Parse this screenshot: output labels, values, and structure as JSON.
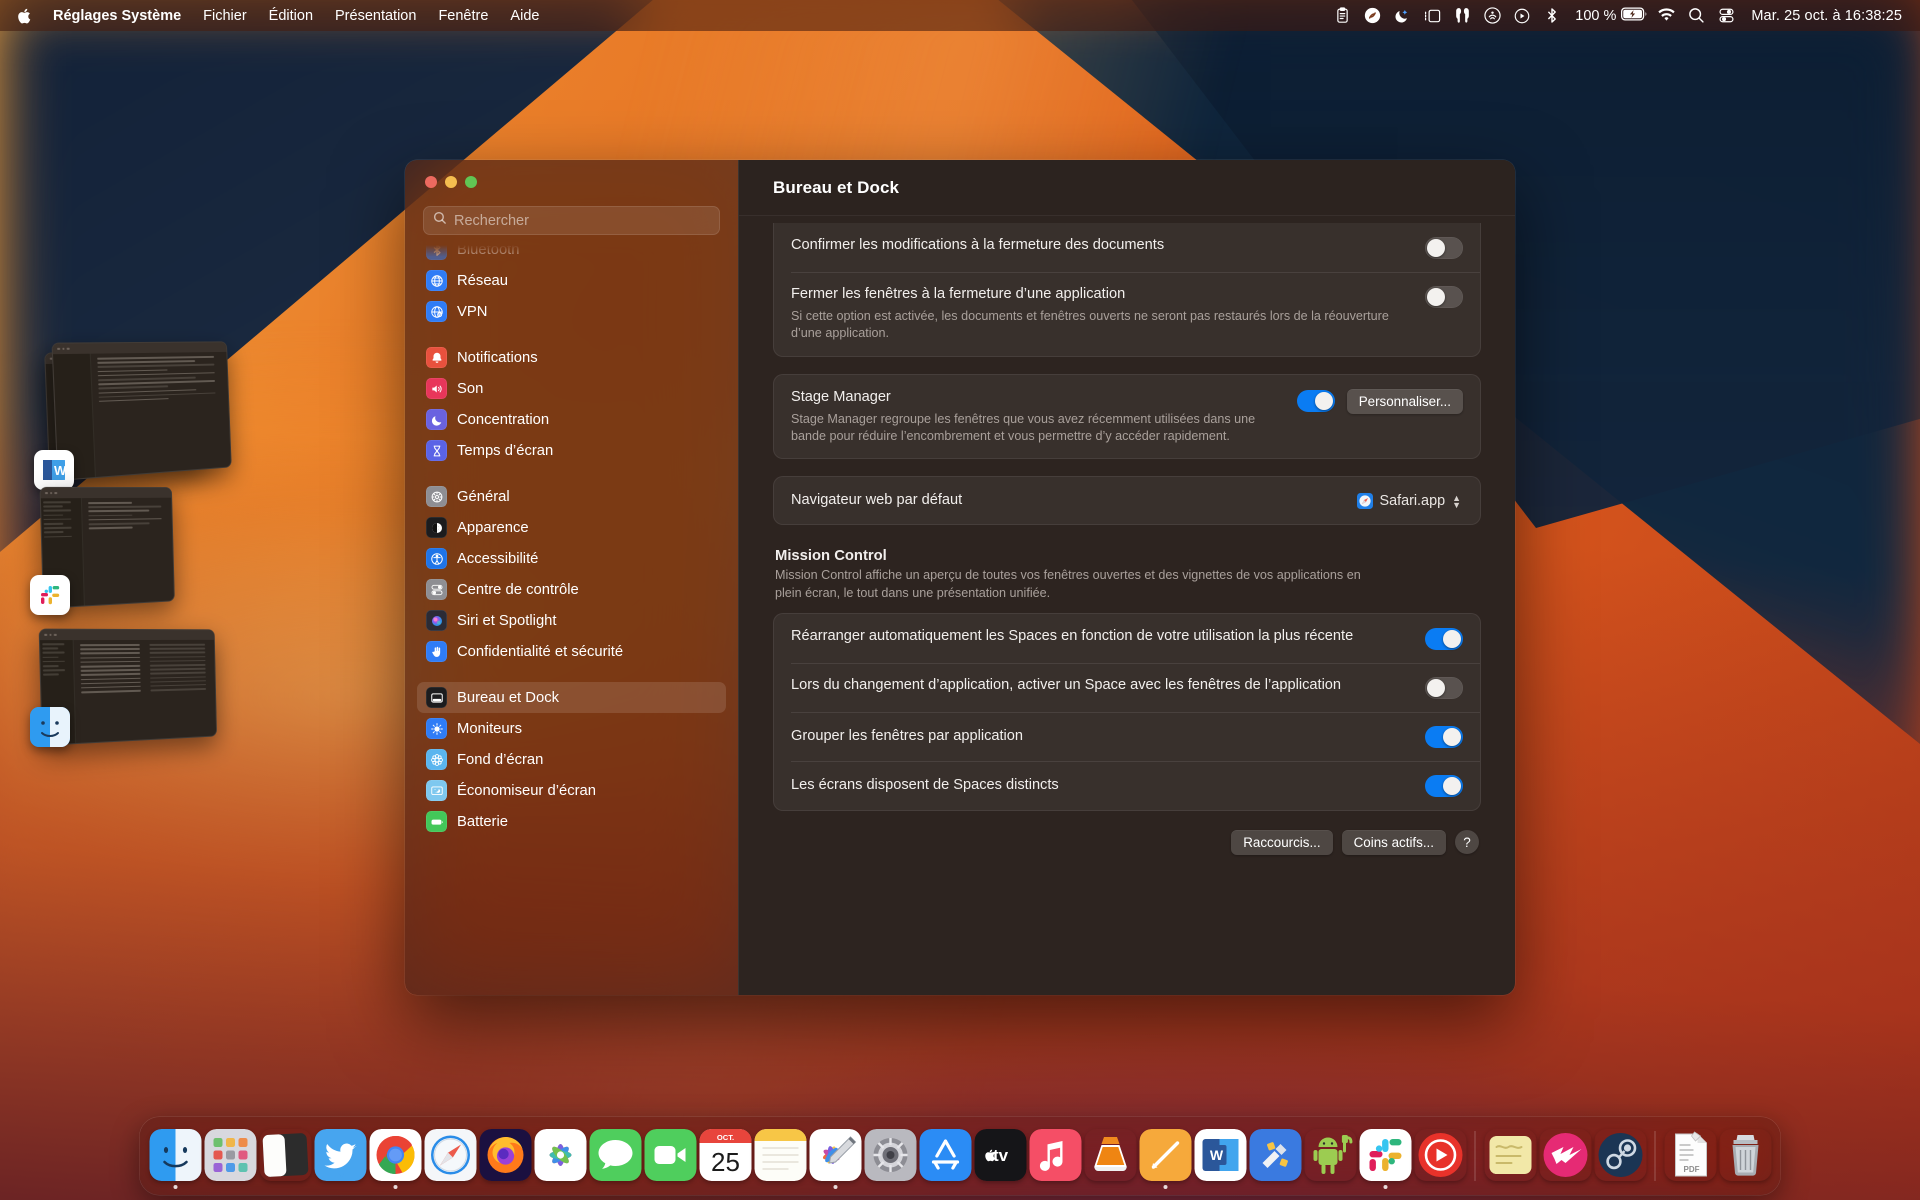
{
  "menubar": {
    "apple_icon": "apple-logo-icon",
    "app_name": "Réglages Système",
    "menus": [
      "Fichier",
      "Édition",
      "Présentation",
      "Fenêtre",
      "Aide"
    ],
    "status_icons": [
      "clipboard-icon",
      "shazam-icon",
      "do-not-disturb-moon-icon",
      "stage-manager-icon",
      "airpods-icon",
      "airdrop-icon",
      "now-playing-icon",
      "bluetooth-icon"
    ],
    "battery_percent": "100 %",
    "battery_icon": "battery-charging-icon",
    "right_icons": [
      "wifi-icon",
      "search-icon",
      "control-center-icon"
    ],
    "clock": "Mar. 25 oct. à 16:38:25"
  },
  "window": {
    "title": "Bureau et Dock",
    "traffic_lights": [
      "close-button",
      "minimize-button",
      "zoom-button"
    ]
  },
  "sidebar": {
    "search_placeholder": "Rechercher",
    "search_value": "",
    "search_icon": "search-icon",
    "groups": [
      {
        "items": [
          {
            "label": "Bluetooth",
            "icon": "bluetooth-icon",
            "color": "#2f7cf6",
            "clipped": true,
            "selected": false
          },
          {
            "label": "Réseau",
            "icon": "globe-icon",
            "color": "#2f7cf6",
            "clipped": false,
            "selected": false
          },
          {
            "label": "VPN",
            "icon": "globe-lock-icon",
            "color": "#2f7cf6",
            "clipped": false,
            "selected": false
          }
        ]
      },
      {
        "items": [
          {
            "label": "Notifications",
            "icon": "bell-icon",
            "color": "#e8513d",
            "clipped": false,
            "selected": false
          },
          {
            "label": "Son",
            "icon": "speaker-icon",
            "color": "#e8365a",
            "clipped": false,
            "selected": false
          },
          {
            "label": "Concentration",
            "icon": "moon-icon",
            "color": "#6a62e0",
            "clipped": false,
            "selected": false
          },
          {
            "label": "Temps d’écran",
            "icon": "hourglass-icon",
            "color": "#5a63e6",
            "clipped": false,
            "selected": false
          }
        ]
      },
      {
        "items": [
          {
            "label": "Général",
            "icon": "gear-icon",
            "color": "#8e8e93",
            "clipped": false,
            "selected": false
          },
          {
            "label": "Apparence",
            "icon": "appearance-icon",
            "color": "#1c1c1e",
            "clipped": false,
            "selected": false
          },
          {
            "label": "Accessibilité",
            "icon": "accessibility-icon",
            "color": "#1f74e8",
            "clipped": false,
            "selected": false
          },
          {
            "label": "Centre de contrôle",
            "icon": "control-center-icon",
            "color": "#8e8e93",
            "clipped": false,
            "selected": false
          },
          {
            "label": "Siri et Spotlight",
            "icon": "siri-icon",
            "color": "#2b2b35",
            "clipped": false,
            "selected": false
          },
          {
            "label": "Confidentialité et sécurité",
            "icon": "hand-icon",
            "color": "#2f7cf6",
            "clipped": false,
            "selected": false
          }
        ]
      },
      {
        "items": [
          {
            "label": "Bureau et Dock",
            "icon": "desktop-dock-icon",
            "color": "#1c1c1e",
            "clipped": false,
            "selected": true
          },
          {
            "label": "Moniteurs",
            "icon": "brightness-icon",
            "color": "#2f7cf6",
            "clipped": false,
            "selected": false
          },
          {
            "label": "Fond d’écran",
            "icon": "wallpaper-icon",
            "color": "#5ab5ef",
            "clipped": false,
            "selected": false
          },
          {
            "label": "Économiseur d’écran",
            "icon": "screensaver-icon",
            "color": "#7ec8ef",
            "clipped": false,
            "selected": false
          },
          {
            "label": "Batterie",
            "icon": "battery-icon",
            "color": "#43c759",
            "clipped": false,
            "selected": false
          }
        ]
      }
    ]
  },
  "main": {
    "windows_group": [
      {
        "label": "Confirmer les modifications à la fermeture des documents",
        "sub": "",
        "toggle": false
      },
      {
        "label": "Fermer les fenêtres à la fermeture d’une application",
        "sub": "Si cette option est activée, les documents et fenêtres ouverts ne seront pas restaurés lors de la réouverture d’une application.",
        "toggle": false
      }
    ],
    "stage_manager": {
      "label": "Stage Manager",
      "sub": "Stage Manager regroupe les fenêtres que vous avez récemment utilisées dans une bande pour réduire l’encombrement et vous permettre d’y accéder rapidement.",
      "toggle": true,
      "button": "Personnaliser..."
    },
    "default_browser": {
      "label": "Navigateur web par défaut",
      "value": "Safari.app",
      "icon": "safari-icon"
    },
    "mission_control": {
      "title": "Mission Control",
      "description": "Mission Control affiche un aperçu de toutes vos fenêtres ouvertes et des vignettes de vos applications en plein écran, le tout dans une présentation unifiée.",
      "rows": [
        {
          "label": "Réarranger automatiquement les Spaces en fonction de votre utilisation la plus récente",
          "toggle": true
        },
        {
          "label": "Lors du changement d’application, activer un Space avec les fenêtres de l’application",
          "toggle": false
        },
        {
          "label": "Grouper les fenêtres par application",
          "toggle": true
        },
        {
          "label": "Les écrans disposent de Spaces distincts",
          "toggle": true
        }
      ]
    },
    "footer": {
      "shortcuts_button": "Raccourcis...",
      "hot_corners_button": "Coins actifs...",
      "help_button": "?"
    }
  },
  "stage_strip": [
    {
      "app": "word-icon",
      "name": "Microsoft Word"
    },
    {
      "app": "slack-icon",
      "name": "Slack"
    },
    {
      "app": "finder-icon",
      "name": "Finder"
    }
  ],
  "dock": {
    "items": [
      {
        "name": "finder-icon",
        "running": true
      },
      {
        "name": "launchpad-icon",
        "running": false
      },
      {
        "name": "notion-icon",
        "running": false
      },
      {
        "name": "twitter-icon",
        "running": false
      },
      {
        "name": "chrome-icon",
        "running": true
      },
      {
        "name": "safari-icon",
        "running": false
      },
      {
        "name": "firefox-icon",
        "running": false
      },
      {
        "name": "photos-icon",
        "running": false
      },
      {
        "name": "messages-icon",
        "running": false
      },
      {
        "name": "facetime-icon",
        "running": false
      },
      {
        "name": "calendar-icon",
        "running": false,
        "month": "OCT.",
        "day": "25"
      },
      {
        "name": "notes-icon",
        "running": false
      },
      {
        "name": "freeform-icon",
        "running": true
      },
      {
        "name": "system-settings-icon",
        "running": false
      },
      {
        "name": "app-store-icon",
        "running": false
      },
      {
        "name": "apple-tv-icon",
        "running": false
      },
      {
        "name": "music-icon",
        "running": false
      },
      {
        "name": "vlc-icon",
        "running": false
      },
      {
        "name": "textedit-icon",
        "running": true
      },
      {
        "name": "word-icon",
        "running": false
      },
      {
        "name": "utilities-icon",
        "running": false
      },
      {
        "name": "android-file-transfer-icon",
        "running": false
      },
      {
        "name": "slack-icon",
        "running": true
      },
      {
        "name": "youtube-music-icon",
        "running": false
      },
      {
        "name": "stickies-icon",
        "running": false
      },
      {
        "name": "hummingbird-icon",
        "running": false
      },
      {
        "name": "steam-icon",
        "running": false
      },
      {
        "name": "pdf-document-icon",
        "running": false
      },
      {
        "name": "trash-icon",
        "running": false
      }
    ]
  },
  "colors": {
    "accent_blue": "#0a7cf3",
    "window_bg": "#2d2420",
    "sidebar_bg": "rgba(72,36,28,0.72)",
    "text_primary": "#f2efed",
    "text_secondary": "#a9a09b",
    "traffic_red": "#ec6a5f",
    "traffic_yellow": "#f4bd4f",
    "traffic_green": "#61c554"
  }
}
